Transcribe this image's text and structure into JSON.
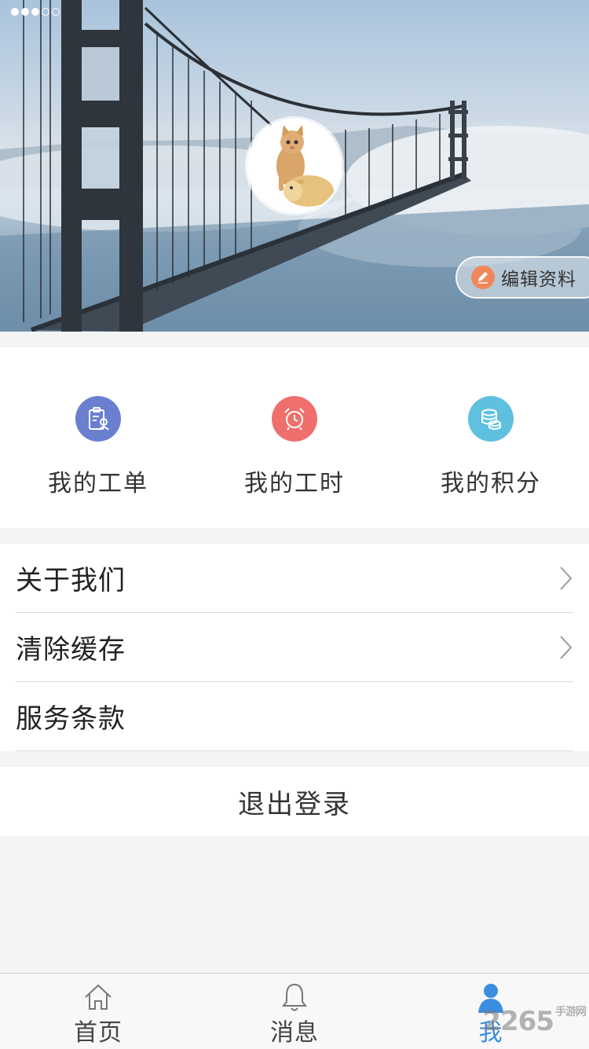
{
  "status_bar": {
    "signal_dots_filled": 3,
    "signal_dots_total": 5
  },
  "header": {
    "avatar_alt": "avatar",
    "edit_profile_label": "编辑资料"
  },
  "shortcuts": [
    {
      "label": "我的工单",
      "icon": "work-order-icon",
      "color": "#6a7fcf"
    },
    {
      "label": "我的工时",
      "icon": "alarm-clock-icon",
      "color": "#ef6f6c"
    },
    {
      "label": "我的积分",
      "icon": "coins-icon",
      "color": "#5fc1df"
    }
  ],
  "menu": [
    {
      "label": "关于我们",
      "has_arrow": true
    },
    {
      "label": "清除缓存",
      "has_arrow": true
    },
    {
      "label": "服务条款",
      "has_arrow": false
    }
  ],
  "logout_label": "退出登录",
  "tabbar": {
    "tabs": [
      {
        "label": "首页",
        "icon": "home-icon",
        "active": false
      },
      {
        "label": "消息",
        "icon": "bell-icon",
        "active": false
      },
      {
        "label": "我",
        "icon": "person-icon",
        "active": true
      }
    ],
    "active_color": "#3b8de0"
  },
  "watermark": {
    "text": "2265",
    "sub": "手游网"
  }
}
